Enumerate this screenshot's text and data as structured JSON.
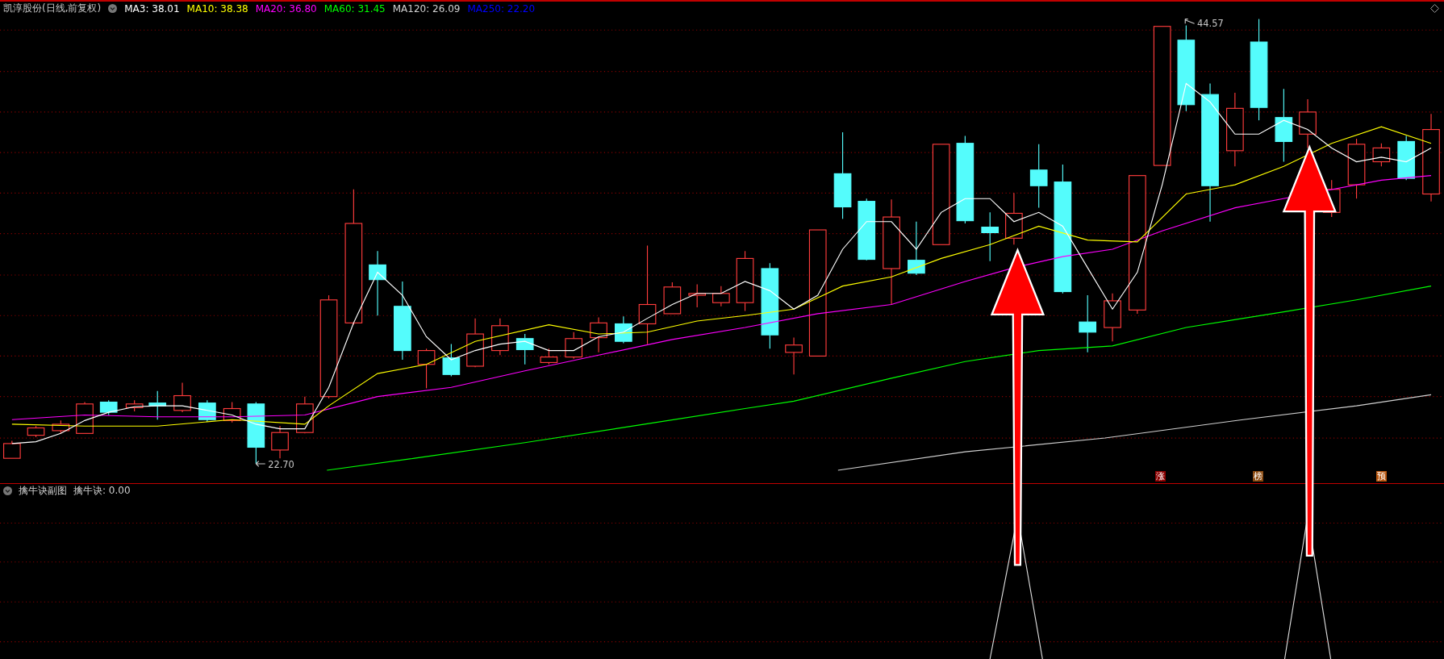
{
  "main_panel": {
    "title": "凯淳股份(日线,前复权)",
    "indicators": [
      {
        "label": "MA3: 38.01",
        "color": "#ffffff"
      },
      {
        "label": "MA10: 38.38",
        "color": "#ffff00"
      },
      {
        "label": "MA20: 36.80",
        "color": "#ff00ff"
      },
      {
        "label": "MA60: 31.45",
        "color": "#00ff00"
      },
      {
        "label": "MA120: 26.09",
        "color": "#d0d0d0"
      },
      {
        "label": "MA250: 22.20",
        "color": "#0000ff"
      }
    ],
    "high_label": "44.57",
    "low_label": "22.70",
    "markers": [
      {
        "label": "涨",
        "color": "#8b0000"
      },
      {
        "label": "榜",
        "color": "#8b4a10"
      },
      {
        "label": "预",
        "color": "#b8560e"
      }
    ]
  },
  "sub_panel": {
    "title": "擒牛诀副图",
    "indicator": "擒牛诀: 0.00"
  }
}
